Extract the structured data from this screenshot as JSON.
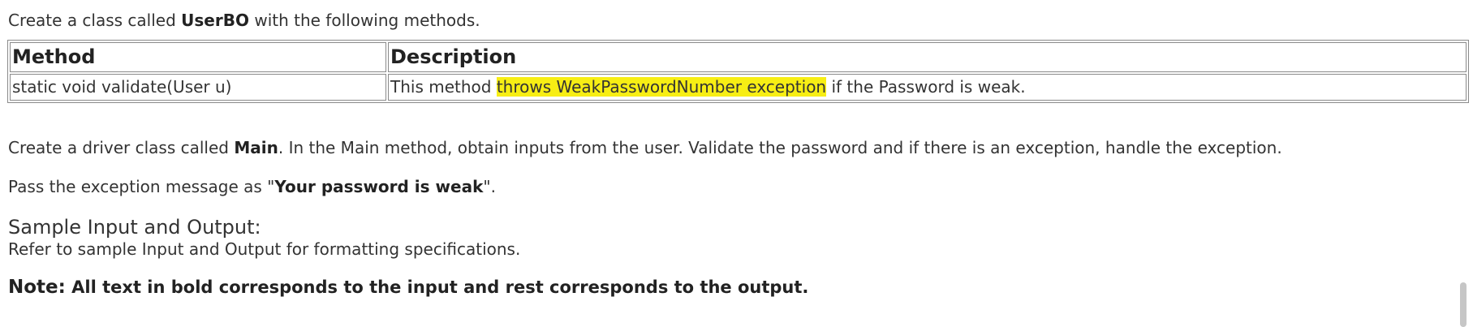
{
  "intro": {
    "pre": "Create a class called ",
    "class_name": "UserBO",
    "post": " with the following methods."
  },
  "methods_table": {
    "headers": [
      "Method",
      "Description"
    ],
    "rows": [
      {
        "method": "static void validate(User u)",
        "description_pre": "This method ",
        "description_highlight": "throws WeakPasswordNumber exception",
        "description_post": " if the Password is weak."
      }
    ]
  },
  "driver": {
    "pre": "Create a driver class called ",
    "class_name": "Main",
    "post": ". In the Main method, obtain inputs from the user. Validate the password and if there is an exception, handle the exception."
  },
  "pass": {
    "pre": "Pass the exception message as \"",
    "message": "Your password is weak",
    "post": "\"."
  },
  "sample": {
    "heading": "Sample Input and Output:",
    "refer": "Refer to sample Input and Output for formatting specifications."
  },
  "note": {
    "lead": "Note:",
    "text": " All text in bold corresponds to the input and rest corresponds to the output."
  },
  "colors": {
    "highlight": "#f7ee14",
    "text": "#333333",
    "border": "#8a8a8a"
  }
}
